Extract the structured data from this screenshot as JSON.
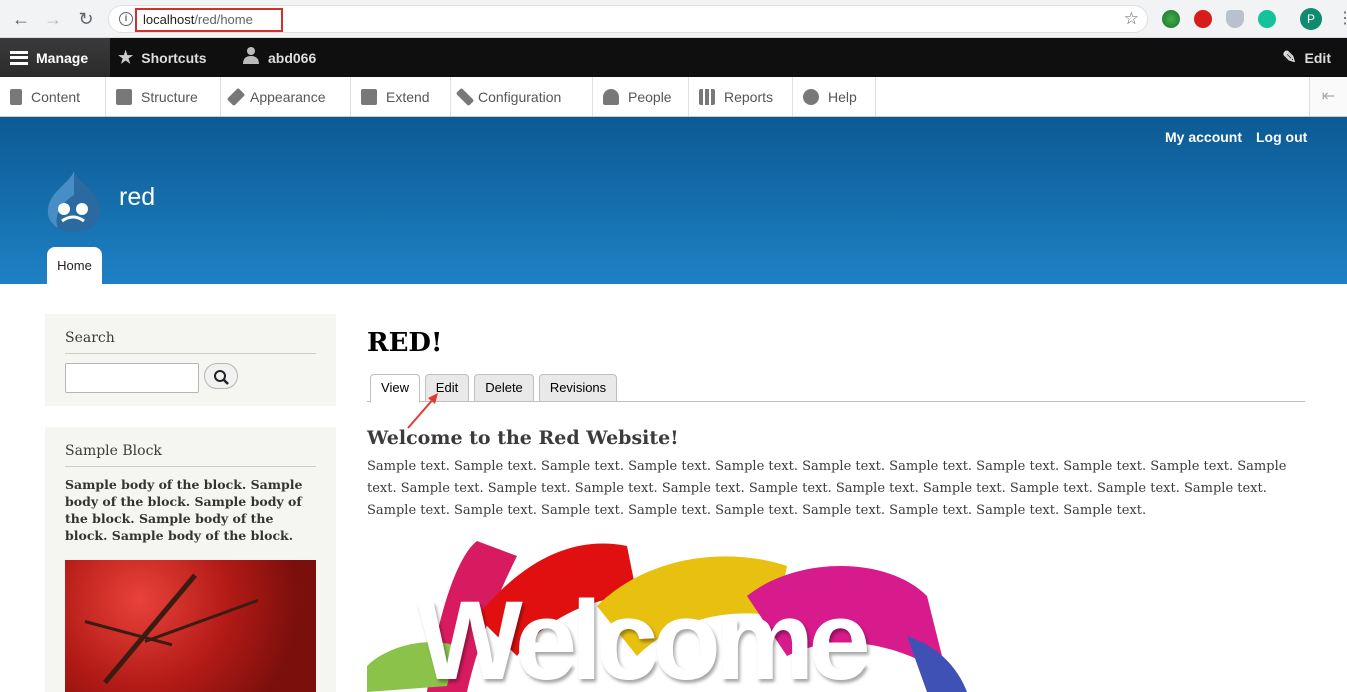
{
  "browser": {
    "url_host": "localhost",
    "url_path": "/red/home",
    "profile_initial": "P"
  },
  "toolbar": {
    "manage": "Manage",
    "shortcuts": "Shortcuts",
    "user": "abd066",
    "edit": "Edit"
  },
  "admin_menu": {
    "items": [
      "Content",
      "Structure",
      "Appearance",
      "Extend",
      "Configuration",
      "People",
      "Reports",
      "Help"
    ]
  },
  "header": {
    "site_name": "red",
    "my_account": "My account",
    "log_out": "Log out",
    "home_tab": "Home"
  },
  "sidebar": {
    "search_title": "Search",
    "sample_block_title": "Sample Block",
    "sample_block_body": "Sample body of the block. Sample body of the block. Sample body of the block. Sample body of the block. Sample body of the block."
  },
  "main": {
    "title": "RED!",
    "tabs": [
      "View",
      "Edit",
      "Delete",
      "Revisions"
    ],
    "heading": "Welcome to the Red Website!",
    "body": "Sample text. Sample text. Sample text. Sample text. Sample text. Sample text. Sample text. Sample text. Sample text. Sample text. Sample text. Sample text. Sample text. Sample text. Sample text. Sample text. Sample text. Sample text. Sample text. Sample text. Sample text. Sample text. Sample text. Sample text. Sample text. Sample text. Sample text. Sample text. Sample text. Sample text.",
    "image_word": "Welcome"
  },
  "colors": {
    "header_top": "#0c5a93",
    "header_bottom": "#1e81c4",
    "toolbar": "#0f0f0f",
    "annotation_red": "#e53935"
  }
}
